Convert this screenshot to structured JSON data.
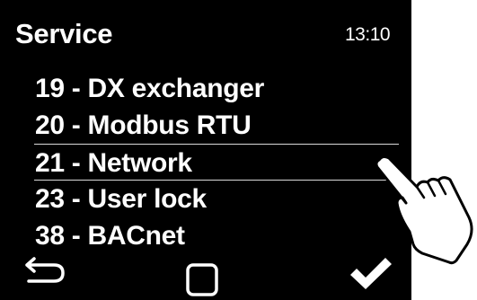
{
  "header": {
    "title": "Service",
    "time": "13:10"
  },
  "menu": {
    "items": [
      {
        "label": "19 - DX exchanger",
        "selected": false
      },
      {
        "label": "20 - Modbus RTU",
        "selected": false
      },
      {
        "label": "21 - Network",
        "selected": true
      },
      {
        "label": "23 - User lock",
        "selected": false
      },
      {
        "label": "38 - BACnet",
        "selected": false
      }
    ]
  },
  "nav": {
    "back_icon": "back-arrow-icon",
    "home_icon": "home-square-icon",
    "confirm_icon": "checkmark-icon"
  },
  "overlay": {
    "pointer_icon": "pointing-hand-icon"
  },
  "colors": {
    "screen_background": "#000000",
    "text": "#ffffff",
    "selection_line": "#d9d9d9",
    "page_background": "#ffffff"
  }
}
